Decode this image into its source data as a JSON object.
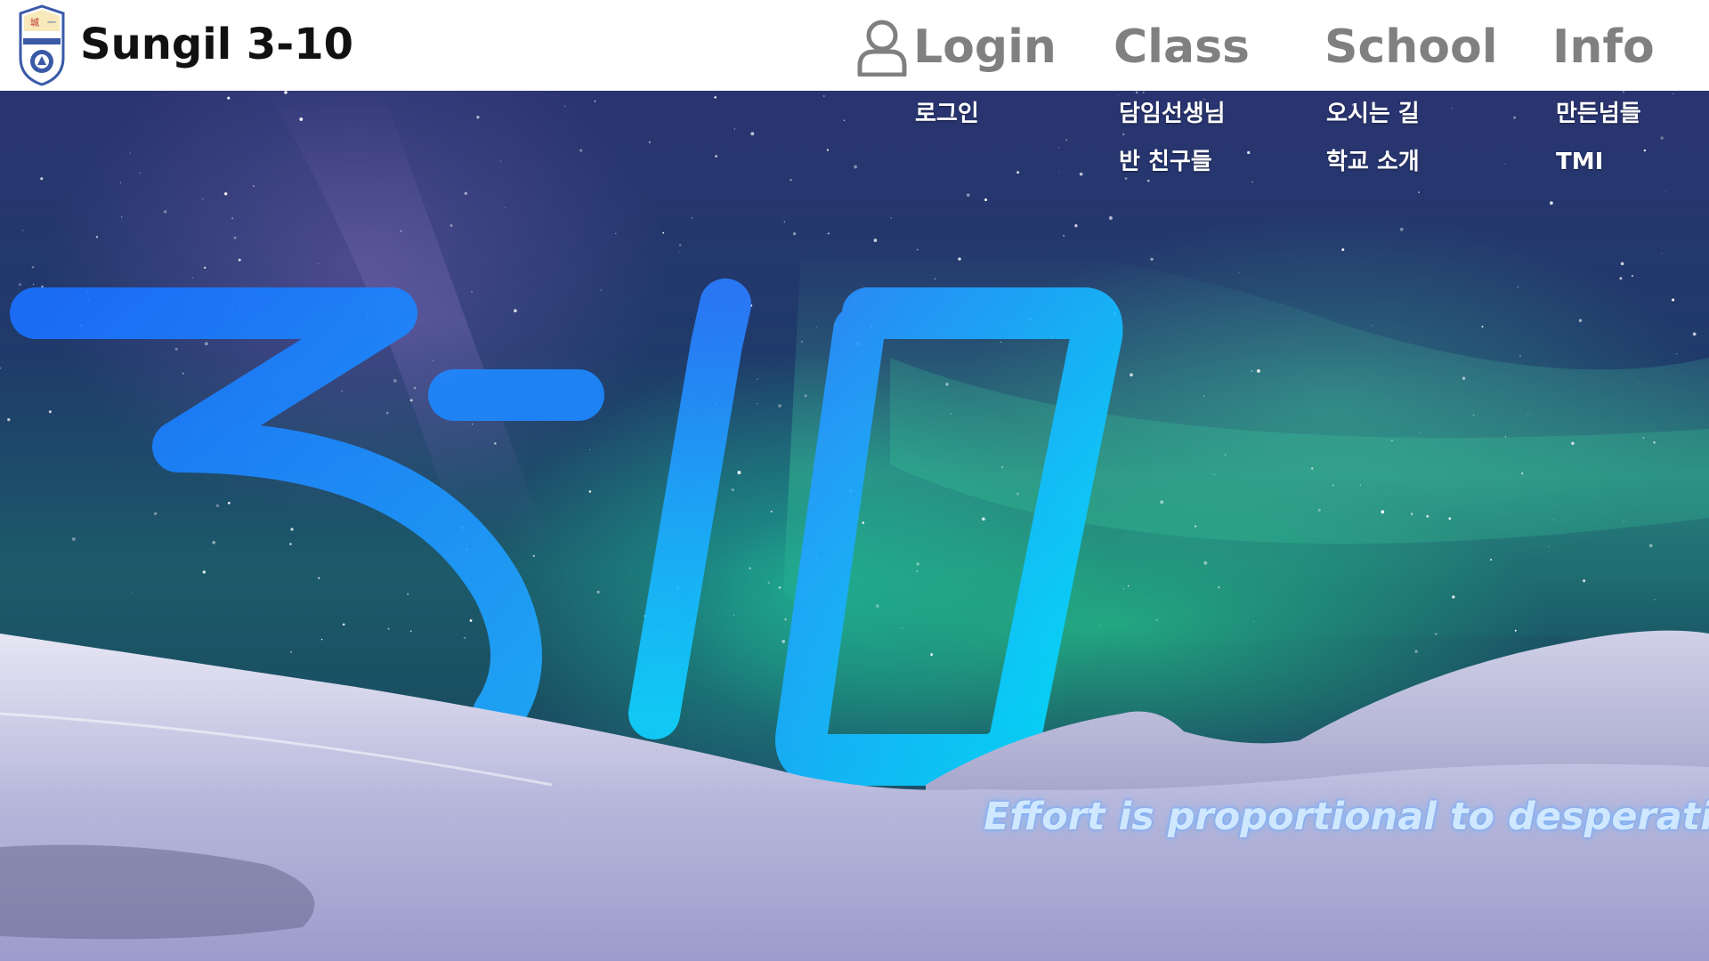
{
  "header": {
    "logo_icon": "school-emblem-icon",
    "title": "Sungil 3-10"
  },
  "nav": {
    "login": {
      "label": "Login",
      "icon": "user-icon",
      "links": [
        "로그인"
      ]
    },
    "class": {
      "label": "Class",
      "links": [
        "담임선생님",
        "반 친구들"
      ]
    },
    "school": {
      "label": "School",
      "links": [
        "오시는 길",
        "학교 소개"
      ]
    },
    "info": {
      "label": "Info",
      "links": [
        "만든넘들",
        "TMI"
      ]
    }
  },
  "hero": {
    "headline_graphic": "3-10",
    "slogan": "Effort is proportional to desperation"
  },
  "colors": {
    "header_bg": "#ffffff",
    "nav_text": "#808080",
    "title_text": "#111111",
    "headline_blue": "#1e90ff",
    "headline_cyan": "#00d8ff"
  }
}
